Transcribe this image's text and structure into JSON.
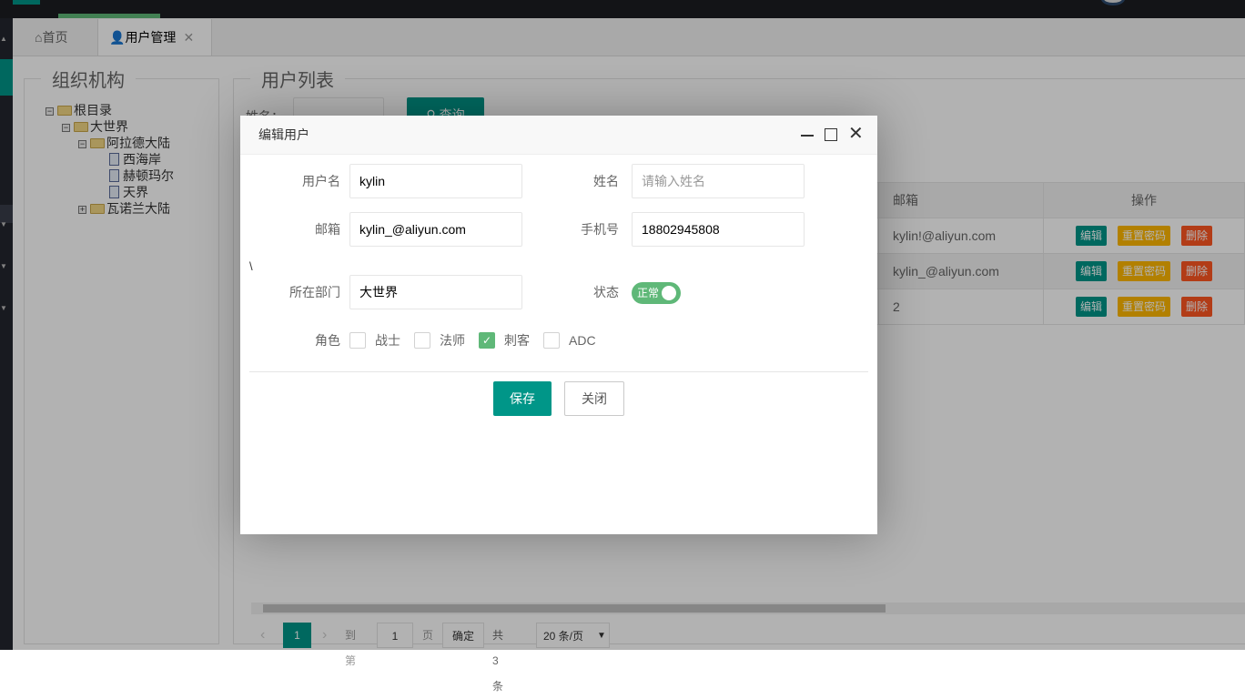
{
  "tabs": [
    {
      "label": "首页",
      "icon": "home-icon"
    },
    {
      "label": "用户管理",
      "icon": "user-icon",
      "close": "✕"
    }
  ],
  "org": {
    "title": "组织机构",
    "tree": [
      {
        "label": "根目录",
        "toggle": "−"
      },
      {
        "label": "大世界",
        "toggle": "−"
      },
      {
        "label": "阿拉德大陆",
        "toggle": "−"
      },
      {
        "label": "西海岸"
      },
      {
        "label": "赫顿玛尔"
      },
      {
        "label": "天界"
      },
      {
        "label": "瓦诺兰大陆",
        "toggle": "+"
      }
    ]
  },
  "users": {
    "title": "用户列表",
    "search_label": "姓名：",
    "search_button": "查询",
    "columns": {
      "email": "邮箱",
      "actions": "操作"
    },
    "rows": [
      {
        "email": "kylin!@aliyun.com"
      },
      {
        "email": "kylin_@aliyun.com"
      },
      {
        "email": "2"
      }
    ],
    "actions": {
      "edit": "编辑",
      "reset": "重置密码",
      "delete": "删除"
    }
  },
  "pager": {
    "current": "1",
    "goto": "到第",
    "goto_value": "1",
    "page": "页",
    "confirm": "确定",
    "total": "共 3 条",
    "page_size": "20 条/页"
  },
  "modal": {
    "title": "编辑用户",
    "stray": "\\",
    "fields": {
      "username_label": "用户名",
      "username": "kylin",
      "name_label": "姓名",
      "name_placeholder": "请输入姓名",
      "email_label": "邮箱",
      "email": "kylin_@aliyun.com",
      "phone_label": "手机号",
      "phone": "18802945808",
      "dept_label": "所在部门",
      "dept": "大世界",
      "status_label": "状态",
      "status": "正常",
      "status_on": true,
      "role_label": "角色",
      "roles": [
        {
          "label": "战士",
          "checked": false
        },
        {
          "label": "法师",
          "checked": false
        },
        {
          "label": "刺客",
          "checked": true
        },
        {
          "label": "ADC",
          "checked": false
        }
      ]
    },
    "save": "保存",
    "close": "关闭"
  },
  "colors": {
    "primary": "#009688",
    "warn": "#ffb800",
    "danger": "#ff5722",
    "switch": "#5fb878"
  }
}
